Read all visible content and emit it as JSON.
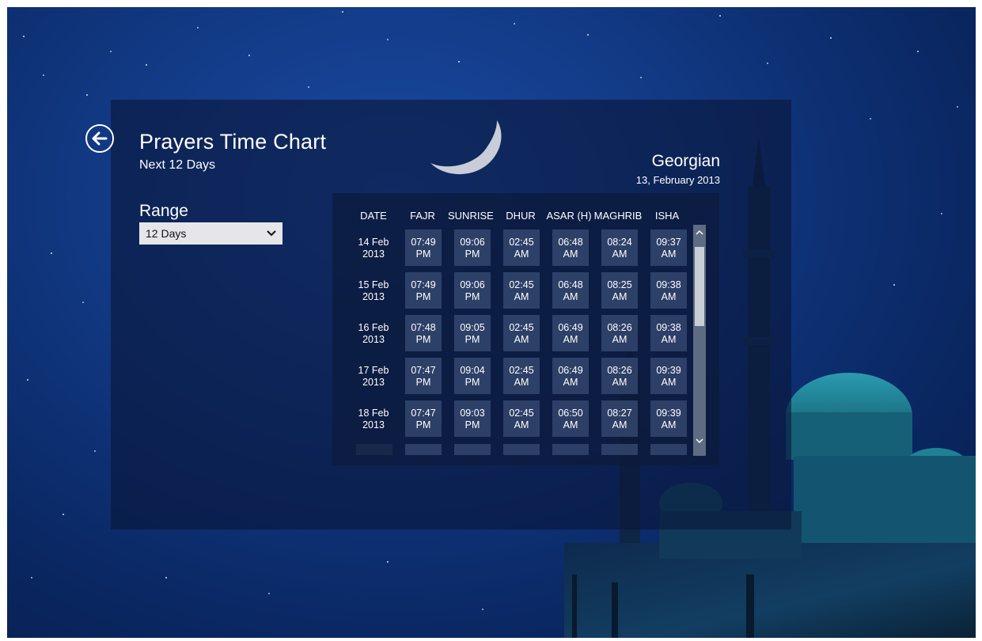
{
  "header": {
    "title": "Prayers Time Chart",
    "subtitle": "Next 12 Days"
  },
  "range": {
    "label": "Range",
    "selected": "12 Days"
  },
  "calendar": {
    "type": "Georgian",
    "date": "13, February 2013"
  },
  "table": {
    "columns": [
      "DATE",
      "FAJR",
      "SUNRISE",
      "DHUR",
      "ASAR (H)",
      "MAGHRIB",
      "ISHA"
    ],
    "rows": [
      {
        "date": [
          "14 Feb",
          "2013"
        ],
        "times": [
          [
            "07:49",
            "PM"
          ],
          [
            "09:06",
            "PM"
          ],
          [
            "02:45",
            "AM"
          ],
          [
            "06:48",
            "AM"
          ],
          [
            "08:24",
            "AM"
          ],
          [
            "09:37",
            "AM"
          ]
        ]
      },
      {
        "date": [
          "15 Feb",
          "2013"
        ],
        "times": [
          [
            "07:49",
            "PM"
          ],
          [
            "09:06",
            "PM"
          ],
          [
            "02:45",
            "AM"
          ],
          [
            "06:48",
            "AM"
          ],
          [
            "08:25",
            "AM"
          ],
          [
            "09:38",
            "AM"
          ]
        ]
      },
      {
        "date": [
          "16 Feb",
          "2013"
        ],
        "times": [
          [
            "07:48",
            "PM"
          ],
          [
            "09:05",
            "PM"
          ],
          [
            "02:45",
            "AM"
          ],
          [
            "06:49",
            "AM"
          ],
          [
            "08:26",
            "AM"
          ],
          [
            "09:38",
            "AM"
          ]
        ]
      },
      {
        "date": [
          "17 Feb",
          "2013"
        ],
        "times": [
          [
            "07:47",
            "PM"
          ],
          [
            "09:04",
            "PM"
          ],
          [
            "02:45",
            "AM"
          ],
          [
            "06:49",
            "AM"
          ],
          [
            "08:26",
            "AM"
          ],
          [
            "09:39",
            "AM"
          ]
        ]
      },
      {
        "date": [
          "18 Feb",
          "2013"
        ],
        "times": [
          [
            "07:47",
            "PM"
          ],
          [
            "09:03",
            "PM"
          ],
          [
            "02:45",
            "AM"
          ],
          [
            "06:50",
            "AM"
          ],
          [
            "08:27",
            "AM"
          ],
          [
            "09:39",
            "AM"
          ]
        ]
      }
    ]
  },
  "icons": {
    "back": "back-arrow-icon",
    "dropdown": "chevron-down-icon",
    "scroll_up": "chevron-up-icon",
    "scroll_down": "chevron-down-icon"
  }
}
